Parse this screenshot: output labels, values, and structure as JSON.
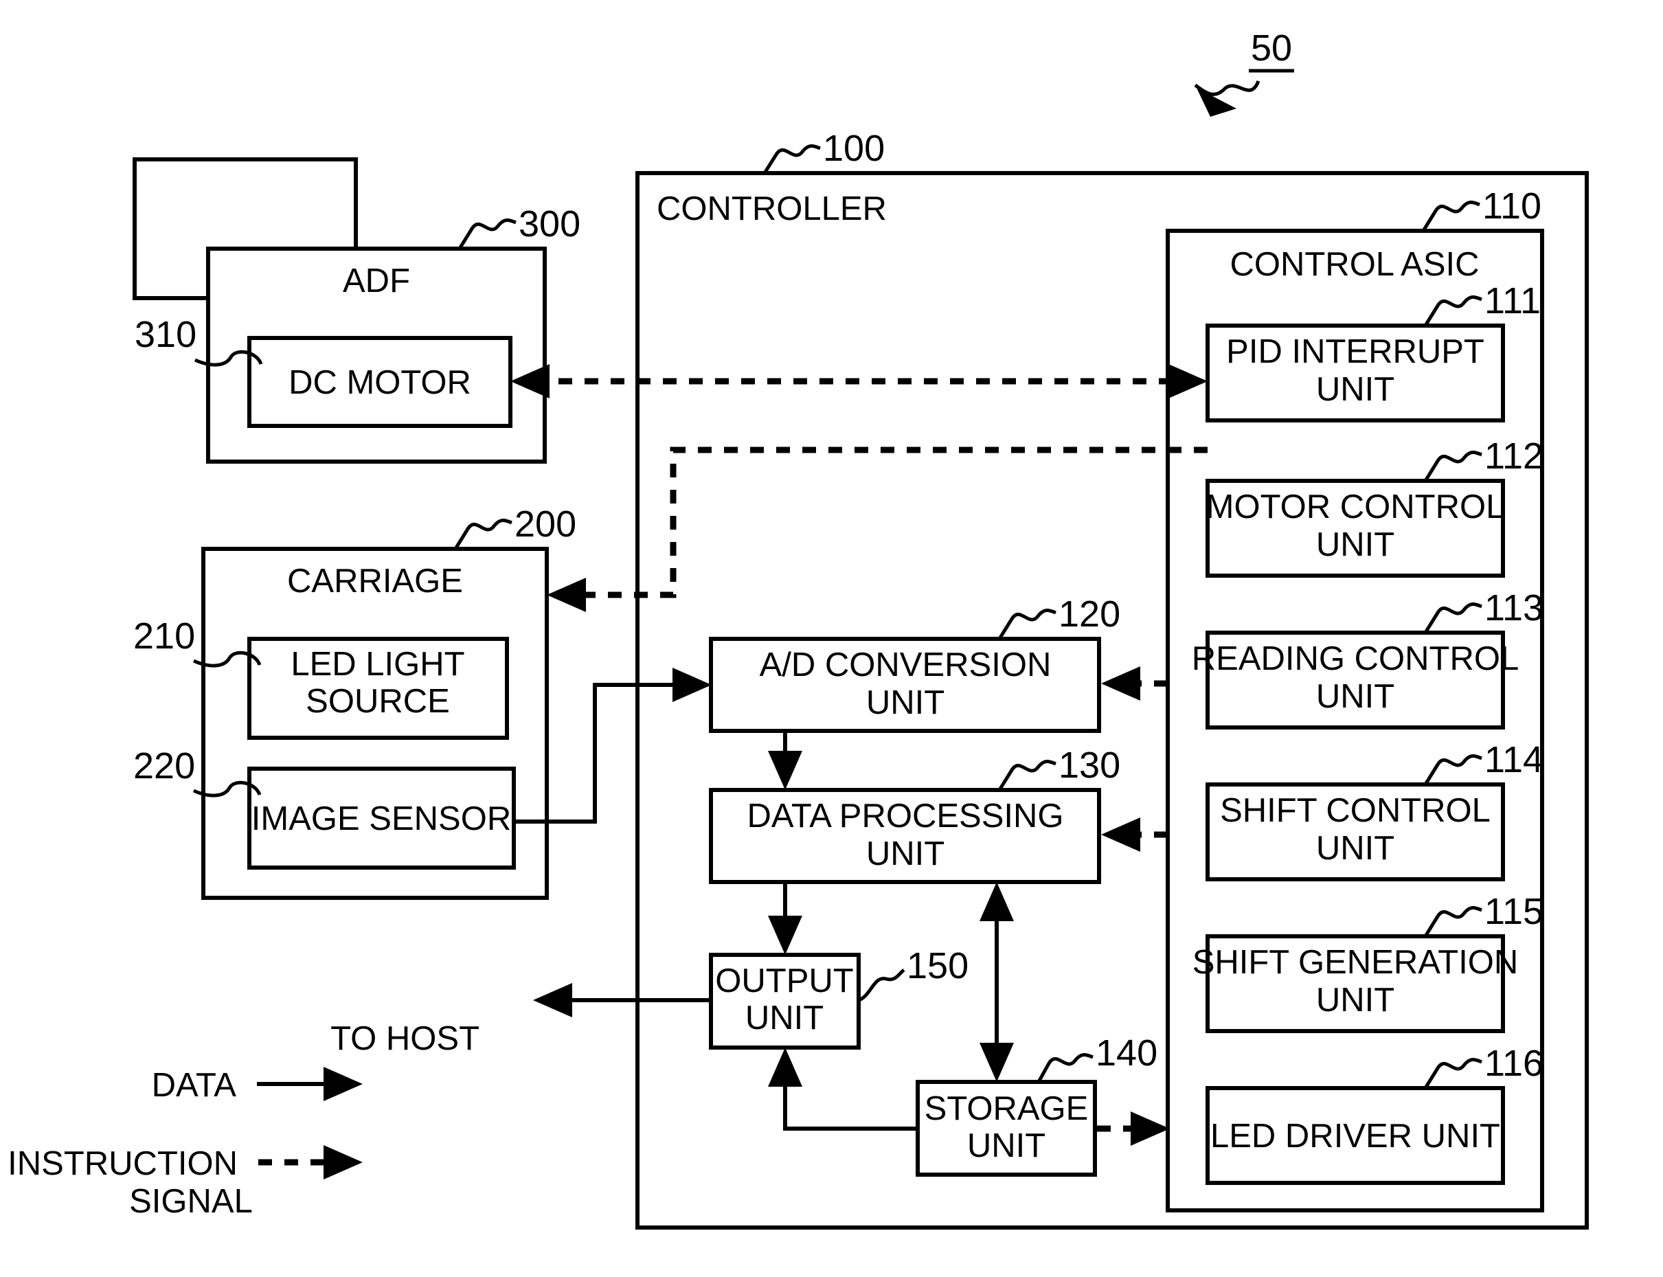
{
  "figure": {
    "overall_ref": "50",
    "legend": {
      "data_label": "DATA",
      "instruction_label_line1": "INSTRUCTION",
      "instruction_label_line2": "SIGNAL"
    },
    "to_host_label": "TO HOST"
  },
  "adf": {
    "title": "ADF",
    "ref": "300",
    "motor": {
      "label": "DC MOTOR",
      "ref": "310"
    }
  },
  "carriage": {
    "title": "CARRIAGE",
    "ref": "200",
    "led": {
      "label_line1": "LED LIGHT",
      "label_line2": "SOURCE",
      "ref": "210"
    },
    "sensor": {
      "label": "IMAGE SENSOR",
      "ref": "220"
    }
  },
  "controller": {
    "title": "CONTROLLER",
    "ref": "100",
    "blocks": [
      {
        "ref": "120",
        "label_line1": "A/D CONVERSION",
        "label_line2": "UNIT"
      },
      {
        "ref": "130",
        "label_line1": "DATA PROCESSING",
        "label_line2": "UNIT"
      },
      {
        "ref": "150",
        "label_line1": "OUTPUT",
        "label_line2": "UNIT"
      },
      {
        "ref": "140",
        "label_line1": "STORAGE",
        "label_line2": "UNIT"
      }
    ],
    "asic": {
      "title": "CONTROL ASIC",
      "ref": "110",
      "units": [
        {
          "ref": "111",
          "label_line1": "PID INTERRUPT",
          "label_line2": "UNIT"
        },
        {
          "ref": "112",
          "label_line1": "MOTOR CONTROL",
          "label_line2": "UNIT"
        },
        {
          "ref": "113",
          "label_line1": "READING CONTROL",
          "label_line2": "UNIT"
        },
        {
          "ref": "114",
          "label_line1": "SHIFT CONTROL",
          "label_line2": "UNIT"
        },
        {
          "ref": "115",
          "label_line1": "SHIFT GENERATION",
          "label_line2": "UNIT"
        },
        {
          "ref": "116",
          "label_line1": "LED DRIVER UNIT",
          "label_line2": ""
        }
      ]
    }
  },
  "colors": {
    "ink": "#000000",
    "paper": "#ffffff"
  }
}
